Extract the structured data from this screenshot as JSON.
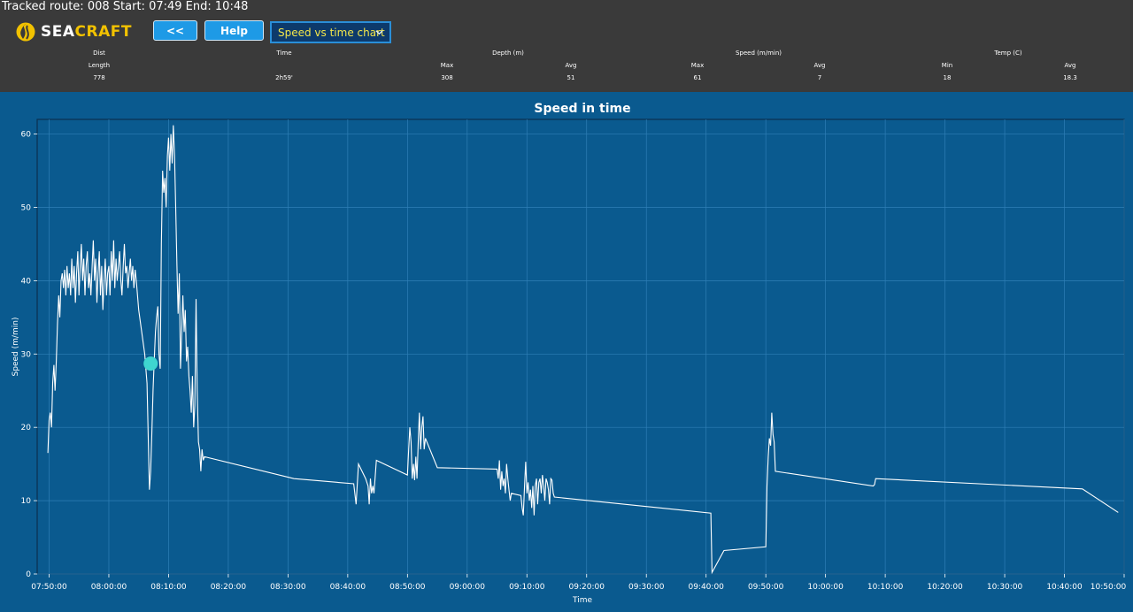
{
  "header": {
    "route_label": "Tracked route:",
    "route_id": "008",
    "start_label": "Start:",
    "start_time": "07:49",
    "end_label": "End:",
    "end_time": "10:48"
  },
  "brand": {
    "prefix": "SEA",
    "suffix": "CRAFT",
    "logo_icon": "seacraft-logo-icon"
  },
  "toolbar": {
    "back_label": "<<",
    "help_label": "Help",
    "chart_select_value": "Speed vs time chart"
  },
  "stats": {
    "groups": [
      {
        "label": "Dist"
      },
      {
        "label": "Time"
      },
      {
        "label": "Depth (m)"
      },
      {
        "label": "Speed (m/min)"
      },
      {
        "label": "Temp (C)"
      }
    ],
    "columns": [
      {
        "label": "Length",
        "value": "778"
      },
      {
        "label": "",
        "value": "2h59'"
      },
      {
        "label": "Max",
        "value": "308"
      },
      {
        "label": "Avg",
        "value": "51"
      },
      {
        "label": "Max",
        "value": "61"
      },
      {
        "label": "Avg",
        "value": "7"
      },
      {
        "label": "Min",
        "value": "18"
      },
      {
        "label": "Avg",
        "value": "18.3"
      }
    ]
  },
  "colors": {
    "header_bg": "#3a3a3a",
    "chart_bg": "#0a5a8f",
    "line": "#ffffff",
    "marker": "#3fd6d0",
    "select_text": "#f3e64a",
    "button": "#1e9ae6"
  },
  "chart_data": {
    "type": "line",
    "title": "Speed in time",
    "xlabel": "Time",
    "ylabel": "Speed (m/min)",
    "xlim": [
      "07:48:00",
      "10:50:00"
    ],
    "ylim": [
      0,
      62
    ],
    "y_ticks": [
      0,
      10,
      20,
      30,
      40,
      50,
      60
    ],
    "x_ticks": [
      "07:50:00",
      "08:00:00",
      "08:10:00",
      "08:20:00",
      "08:30:00",
      "08:40:00",
      "08:50:00",
      "09:00:00",
      "09:10:00",
      "09:20:00",
      "09:30:00",
      "09:40:00",
      "09:50:00",
      "10:00:00",
      "10:10:00",
      "10:20:00",
      "10:30:00",
      "10:40:00",
      "10:50:00"
    ],
    "grid": true,
    "series": [
      {
        "points": [
          [
            "07:49:48",
            16.5
          ],
          [
            "07:50:00",
            21
          ],
          [
            "07:50:12",
            22
          ],
          [
            "07:50:24",
            20
          ],
          [
            "07:50:36",
            26
          ],
          [
            "07:50:48",
            28.5
          ],
          [
            "07:51:00",
            25
          ],
          [
            "07:51:12",
            29
          ],
          [
            "07:51:24",
            34
          ],
          [
            "07:51:36",
            38
          ],
          [
            "07:51:48",
            35
          ],
          [
            "07:52:00",
            40
          ],
          [
            "07:52:12",
            41
          ],
          [
            "07:52:24",
            39
          ],
          [
            "07:52:36",
            41.5
          ],
          [
            "07:52:48",
            38
          ],
          [
            "07:53:00",
            42
          ],
          [
            "07:53:12",
            39
          ],
          [
            "07:53:24",
            41
          ],
          [
            "07:53:36",
            38
          ],
          [
            "07:53:48",
            43
          ],
          [
            "07:54:00",
            39
          ],
          [
            "07:54:12",
            42
          ],
          [
            "07:54:24",
            37
          ],
          [
            "07:54:36",
            41
          ],
          [
            "07:54:48",
            44
          ],
          [
            "07:55:00",
            38
          ],
          [
            "07:55:12",
            42
          ],
          [
            "07:55:24",
            45
          ],
          [
            "07:55:36",
            40
          ],
          [
            "07:55:48",
            43
          ],
          [
            "07:56:00",
            38
          ],
          [
            "07:56:12",
            42
          ],
          [
            "07:56:24",
            44
          ],
          [
            "07:56:36",
            39
          ],
          [
            "07:56:48",
            41
          ],
          [
            "07:57:00",
            38
          ],
          [
            "07:57:12",
            42
          ],
          [
            "07:57:24",
            45.5
          ],
          [
            "07:57:36",
            40
          ],
          [
            "07:57:48",
            43
          ],
          [
            "07:58:00",
            37
          ],
          [
            "07:58:12",
            41
          ],
          [
            "07:58:24",
            44
          ],
          [
            "07:58:36",
            38
          ],
          [
            "07:58:48",
            42
          ],
          [
            "07:59:00",
            36
          ],
          [
            "07:59:12",
            40
          ],
          [
            "07:59:24",
            43
          ],
          [
            "07:59:36",
            38
          ],
          [
            "07:59:48",
            41
          ],
          [
            "08:00:00",
            42
          ],
          [
            "08:00:12",
            38
          ],
          [
            "08:00:24",
            44
          ],
          [
            "08:00:36",
            40
          ],
          [
            "08:00:48",
            45.5
          ],
          [
            "08:01:00",
            39
          ],
          [
            "08:01:12",
            43
          ],
          [
            "08:01:24",
            40
          ],
          [
            "08:01:36",
            42
          ],
          [
            "08:01:48",
            44
          ],
          [
            "08:02:00",
            40
          ],
          [
            "08:02:12",
            38
          ],
          [
            "08:02:24",
            42
          ],
          [
            "08:02:36",
            45
          ],
          [
            "08:02:48",
            41
          ],
          [
            "08:03:00",
            42
          ],
          [
            "08:03:12",
            39
          ],
          [
            "08:03:24",
            41
          ],
          [
            "08:03:36",
            43
          ],
          [
            "08:03:48",
            40
          ],
          [
            "08:04:00",
            42
          ],
          [
            "08:04:12",
            39
          ],
          [
            "08:04:24",
            41.5
          ],
          [
            "08:04:36",
            40
          ],
          [
            "08:05:00",
            36
          ],
          [
            "08:05:30",
            33
          ],
          [
            "08:06:00",
            30
          ],
          [
            "08:06:24",
            26
          ],
          [
            "08:06:48",
            11.5
          ],
          [
            "08:07:00",
            14
          ],
          [
            "08:07:12",
            19
          ],
          [
            "08:07:24",
            25
          ],
          [
            "08:07:36",
            29
          ],
          [
            "08:07:48",
            33
          ],
          [
            "08:08:00",
            35
          ],
          [
            "08:08:12",
            36.5
          ],
          [
            "08:08:24",
            30
          ],
          [
            "08:08:36",
            28
          ],
          [
            "08:08:48",
            45
          ],
          [
            "08:09:00",
            55
          ],
          [
            "08:09:12",
            52
          ],
          [
            "08:09:24",
            54
          ],
          [
            "08:09:36",
            50
          ],
          [
            "08:09:48",
            57
          ],
          [
            "08:10:00",
            59.5
          ],
          [
            "08:10:12",
            55
          ],
          [
            "08:10:24",
            60
          ],
          [
            "08:10:36",
            56
          ],
          [
            "08:10:48",
            61.2
          ],
          [
            "08:11:00",
            57
          ],
          [
            "08:11:12",
            50
          ],
          [
            "08:11:24",
            42
          ],
          [
            "08:11:36",
            35.5
          ],
          [
            "08:11:48",
            41
          ],
          [
            "08:12:00",
            28
          ],
          [
            "08:12:12",
            33
          ],
          [
            "08:12:24",
            38
          ],
          [
            "08:12:36",
            33
          ],
          [
            "08:12:48",
            36
          ],
          [
            "08:13:00",
            29
          ],
          [
            "08:13:12",
            31
          ],
          [
            "08:13:24",
            27
          ],
          [
            "08:13:36",
            25
          ],
          [
            "08:13:48",
            22
          ],
          [
            "08:14:00",
            27
          ],
          [
            "08:14:12",
            20
          ],
          [
            "08:14:24",
            23
          ],
          [
            "08:14:36",
            37.5
          ],
          [
            "08:14:48",
            25
          ],
          [
            "08:15:00",
            18
          ],
          [
            "08:15:12",
            17
          ],
          [
            "08:15:24",
            14
          ],
          [
            "08:15:36",
            17
          ],
          [
            "08:15:48",
            15.5
          ],
          [
            "08:16:00",
            16
          ],
          [
            "08:31:00",
            13
          ],
          [
            "08:41:00",
            12.3
          ],
          [
            "08:41:24",
            9.5
          ],
          [
            "08:41:48",
            15
          ],
          [
            "08:43:00",
            13
          ],
          [
            "08:43:24",
            12
          ],
          [
            "08:43:36",
            9.5
          ],
          [
            "08:43:48",
            13
          ],
          [
            "08:44:00",
            11
          ],
          [
            "08:44:12",
            12
          ],
          [
            "08:44:24",
            11
          ],
          [
            "08:44:48",
            15.5
          ],
          [
            "08:50:00",
            13.5
          ],
          [
            "08:50:12",
            17
          ],
          [
            "08:50:24",
            20
          ],
          [
            "08:50:36",
            18
          ],
          [
            "08:50:48",
            13
          ],
          [
            "08:51:00",
            15
          ],
          [
            "08:51:12",
            12.8
          ],
          [
            "08:51:24",
            16
          ],
          [
            "08:51:36",
            13
          ],
          [
            "08:51:48",
            18
          ],
          [
            "08:52:00",
            22
          ],
          [
            "08:52:12",
            17
          ],
          [
            "08:52:24",
            20
          ],
          [
            "08:52:36",
            21.5
          ],
          [
            "08:52:48",
            17
          ],
          [
            "08:53:00",
            18.5
          ],
          [
            "08:55:00",
            14.5
          ],
          [
            "09:05:00",
            14.3
          ],
          [
            "09:05:12",
            13
          ],
          [
            "09:05:24",
            15.5
          ],
          [
            "09:05:36",
            11.5
          ],
          [
            "09:05:48",
            14
          ],
          [
            "09:06:00",
            12
          ],
          [
            "09:06:12",
            13
          ],
          [
            "09:06:24",
            11
          ],
          [
            "09:06:36",
            15
          ],
          [
            "09:06:48",
            13
          ],
          [
            "09:07:00",
            11.5
          ],
          [
            "09:07:12",
            10
          ],
          [
            "09:07:24",
            11
          ],
          [
            "09:09:00",
            10.7
          ],
          [
            "09:09:12",
            9
          ],
          [
            "09:09:24",
            8
          ],
          [
            "09:09:36",
            12
          ],
          [
            "09:09:48",
            15.3
          ],
          [
            "09:10:00",
            11
          ],
          [
            "09:10:12",
            12.5
          ],
          [
            "09:10:24",
            10
          ],
          [
            "09:10:36",
            11.5
          ],
          [
            "09:10:48",
            9
          ],
          [
            "09:11:00",
            12
          ],
          [
            "09:11:12",
            8
          ],
          [
            "09:11:24",
            12
          ],
          [
            "09:11:36",
            13
          ],
          [
            "09:11:48",
            9.5
          ],
          [
            "09:12:00",
            12.5
          ],
          [
            "09:12:12",
            13
          ],
          [
            "09:12:24",
            11
          ],
          [
            "09:12:36",
            13.5
          ],
          [
            "09:12:48",
            12
          ],
          [
            "09:13:00",
            10
          ],
          [
            "09:13:12",
            13
          ],
          [
            "09:13:24",
            12.5
          ],
          [
            "09:13:36",
            11.5
          ],
          [
            "09:13:48",
            9.5
          ],
          [
            "09:14:00",
            13
          ],
          [
            "09:14:12",
            12.8
          ],
          [
            "09:14:24",
            11
          ],
          [
            "09:14:36",
            10.5
          ],
          [
            "09:40:48",
            8.3
          ],
          [
            "09:41:00",
            0.2
          ],
          [
            "09:43:00",
            3.2
          ],
          [
            "09:50:00",
            3.7
          ],
          [
            "09:50:12",
            12
          ],
          [
            "09:50:24",
            16
          ],
          [
            "09:50:36",
            18.5
          ],
          [
            "09:50:48",
            17.5
          ],
          [
            "09:51:00",
            22
          ],
          [
            "09:51:12",
            19
          ],
          [
            "09:51:24",
            18
          ],
          [
            "09:51:36",
            14
          ],
          [
            "10:08:00",
            12
          ],
          [
            "10:08:12",
            12.2
          ],
          [
            "10:08:24",
            13
          ],
          [
            "10:43:00",
            11.6
          ],
          [
            "10:49:00",
            8.4
          ]
        ]
      }
    ],
    "marker": {
      "x": "08:07:00",
      "y": 28.7
    }
  }
}
